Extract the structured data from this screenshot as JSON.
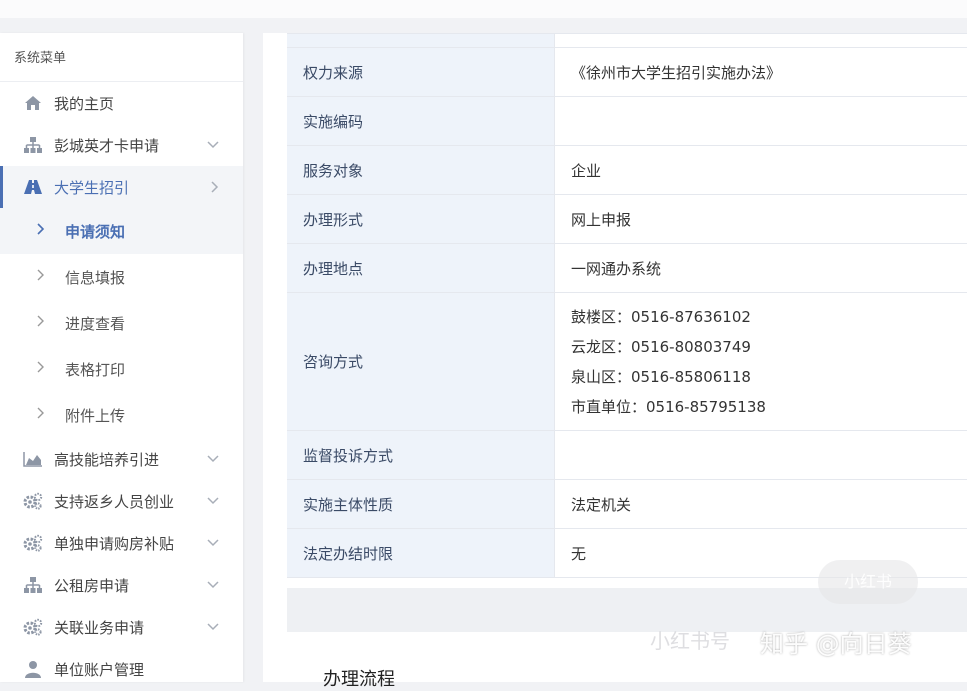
{
  "sidebar": {
    "title": "系统菜单",
    "items": [
      {
        "label": "我的主页",
        "icon": "home-icon",
        "has_chevron": false
      },
      {
        "label": "彭城英才卡申请",
        "icon": "org-chart-icon",
        "has_chevron": true
      },
      {
        "label": "大学生招引",
        "icon": "road-icon",
        "has_chevron": true,
        "active": true
      },
      {
        "label": "高技能培养引进",
        "icon": "area-chart-icon",
        "has_chevron": true
      },
      {
        "label": "支持返乡人员创业",
        "icon": "gears-icon",
        "has_chevron": true
      },
      {
        "label": "单独申请购房补贴",
        "icon": "gears-icon",
        "has_chevron": true
      },
      {
        "label": "公租房申请",
        "icon": "org-chart-icon",
        "has_chevron": true
      },
      {
        "label": "关联业务申请",
        "icon": "gears-icon",
        "has_chevron": true
      },
      {
        "label": "单位账户管理",
        "icon": "user-icon",
        "has_chevron": false
      }
    ],
    "subitems": [
      {
        "label": "申请须知",
        "current": true
      },
      {
        "label": "信息填报"
      },
      {
        "label": "进度查看"
      },
      {
        "label": "表格打印"
      },
      {
        "label": "附件上传"
      }
    ]
  },
  "table": {
    "rows": [
      {
        "label": "权力来源",
        "value": "《徐州市大学生招引实施办法》"
      },
      {
        "label": "实施编码",
        "value": ""
      },
      {
        "label": "服务对象",
        "value": "企业"
      },
      {
        "label": "办理形式",
        "value": "网上申报"
      },
      {
        "label": "办理地点",
        "value": "一网通办系统"
      },
      {
        "label": "咨询方式",
        "lines": [
          "鼓楼区：0516-87636102",
          "云龙区：0516-80803749",
          "泉山区：0516-85806118",
          "市直单位：0516-85795138"
        ]
      },
      {
        "label": "监督投诉方式",
        "value": ""
      },
      {
        "label": "实施主体性质",
        "value": "法定机关"
      },
      {
        "label": "法定办结时限",
        "value": "无"
      }
    ]
  },
  "section": {
    "title": "办理流程"
  },
  "watermark": {
    "text1": "小红书号",
    "text2": "知乎 @向日葵",
    "logo": "小红书"
  },
  "colors": {
    "accent": "#4a6fb3",
    "label_bg": "#eef3fa"
  }
}
